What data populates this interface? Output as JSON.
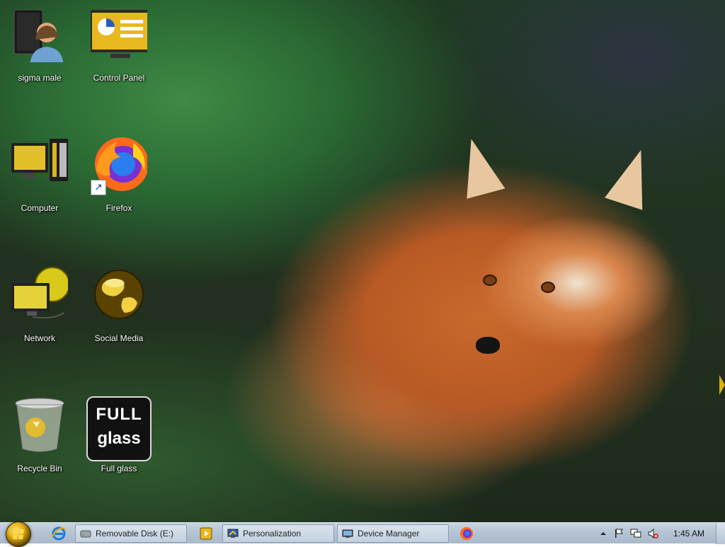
{
  "desktop": {
    "icons": [
      {
        "label": "sigma male",
        "icon": "user-folder-icon"
      },
      {
        "label": "Control Panel",
        "icon": "control-panel-icon"
      },
      {
        "label": "Computer",
        "icon": "computer-icon"
      },
      {
        "label": "Firefox",
        "icon": "firefox-icon"
      },
      {
        "label": "Network",
        "icon": "network-icon"
      },
      {
        "label": "Social Media",
        "icon": "globe-icon"
      },
      {
        "label": "Recycle Bin",
        "icon": "recycle-bin-icon"
      },
      {
        "label": "Full glass",
        "icon": "full-glass-icon",
        "art_text": [
          "FULL",
          "glass"
        ]
      }
    ]
  },
  "taskbar": {
    "quick_launch": [
      {
        "icon": "internet-explorer-icon"
      },
      {
        "icon": "media-player-icon"
      }
    ],
    "buttons": [
      {
        "label": "Removable Disk (E:)",
        "icon": "drive-icon"
      },
      {
        "label": "Personalization",
        "icon": "personalization-icon"
      },
      {
        "label": "Device Manager",
        "icon": "device-manager-icon"
      }
    ],
    "pinned": [
      {
        "icon": "firefox-icon"
      }
    ],
    "tray": [
      "chevron-up-icon",
      "flag-icon",
      "network-icon",
      "volume-muted-icon"
    ],
    "clock": "1:45 AM"
  },
  "colors": {
    "taskbar": "#b7c6d6",
    "accent": "#e7b21a"
  }
}
